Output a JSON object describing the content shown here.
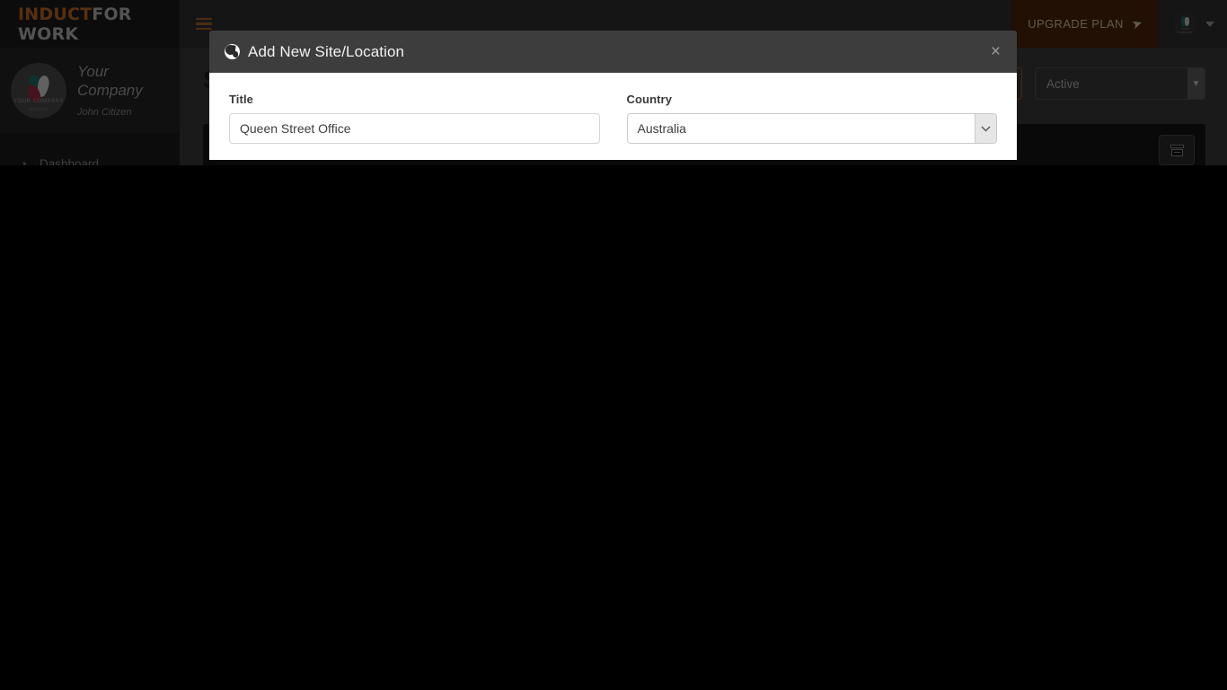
{
  "brand": {
    "part1": "INDUCT",
    "part2": "FOR WORK"
  },
  "sidebar": {
    "company": {
      "name": "Your Company",
      "user": "John Citizen",
      "logo_caption": "YOUR COMPANY",
      "logo_subcaption": "SLOGAN"
    },
    "items": [
      {
        "icon": "dashboard-icon",
        "glyph": "◔",
        "label": "Dashboard"
      }
    ]
  },
  "topbar": {
    "menu_toggle": "hamburger-icon",
    "upgrade_label": "UPGRADE PLAN",
    "upgrade_icon": "paper-plane-icon",
    "upgrade_bg": "#4a2508",
    "user_caret": "chevron-down-icon"
  },
  "content": {
    "page_title": "S",
    "status_filter": {
      "value": "Active",
      "arrow": "chevron-down-icon"
    },
    "archive_button_icon": "archive-box-icon"
  },
  "modal": {
    "icon": "globe-icon",
    "title": "Add New Site/Location",
    "close_label": "×",
    "fields": {
      "title": {
        "label": "Title",
        "value": "Queen Street Office",
        "placeholder": "Title"
      },
      "country": {
        "label": "Country",
        "value": "Australia",
        "arrow": "chevron-down-icon"
      }
    }
  },
  "colors": {
    "accent_orange": "#c06a23",
    "sidebar_bg": "#1b1b1b",
    "topbar_bg": "#2f2f2f",
    "modal_header_bg": "#3d3d3d",
    "content_bg": "#3a3a3a"
  }
}
